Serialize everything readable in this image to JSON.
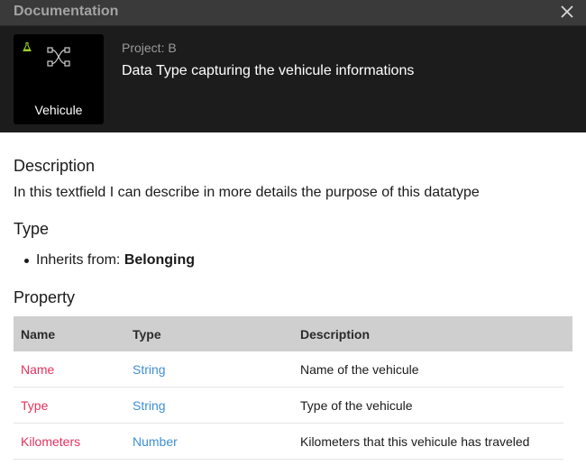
{
  "window": {
    "title": "Documentation",
    "close_icon": "close-icon"
  },
  "header": {
    "tile_label": "Vehicule",
    "tile_icon": "node-graph-icon",
    "badge_icon": "flask-icon",
    "badge_color": "#9acd32",
    "project": "Project: B",
    "summary": "Data Type capturing the vehicule informations"
  },
  "description": {
    "heading": "Description",
    "text": "In this textfield I can describe in more details the purpose of this datatype"
  },
  "type": {
    "heading": "Type",
    "inherits_label": "Inherits from:",
    "inherits_value": "Belonging"
  },
  "property": {
    "heading": "Property",
    "columns": [
      "Name",
      "Type",
      "Description"
    ],
    "rows": [
      {
        "name": "Name",
        "type": "String",
        "description": "Name of the vehicule"
      },
      {
        "name": "Type",
        "type": "String",
        "description": "Type of the vehicule"
      },
      {
        "name": "Kilometers",
        "type": "Number",
        "description": "Kilometers that this vehicule has traveled"
      }
    ]
  },
  "colors": {
    "property_name": "#e4325e",
    "property_type": "#3f8fd6",
    "header_bg": "#1c1c1c",
    "titlebar_bg": "#3a3a3a"
  }
}
